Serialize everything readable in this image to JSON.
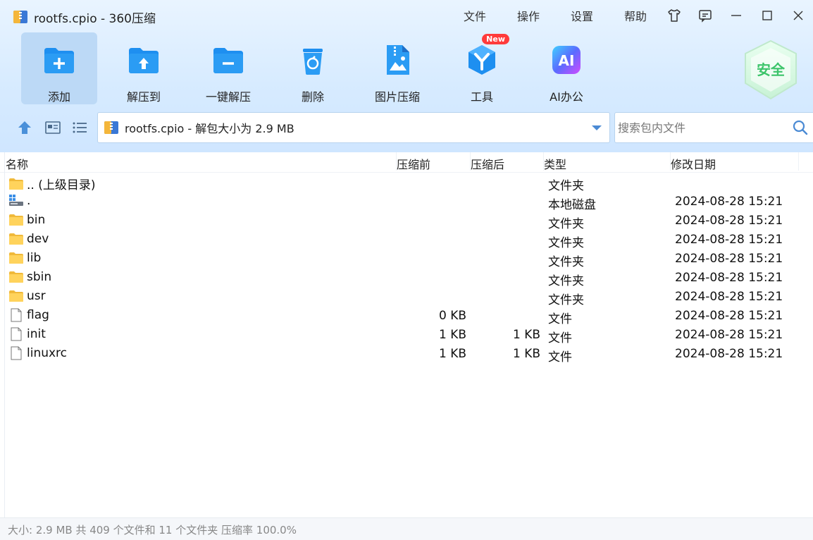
{
  "window": {
    "title": "rootfs.cpio - 360压缩"
  },
  "menu": [
    "文件",
    "操作",
    "设置",
    "帮助"
  ],
  "toolbar": [
    {
      "label": "添加",
      "icon": "add-folder-icon",
      "active": true
    },
    {
      "label": "解压到",
      "icon": "extract-to-icon"
    },
    {
      "label": "一键解压",
      "icon": "one-click-extract-icon"
    },
    {
      "label": "删除",
      "icon": "delete-icon"
    },
    {
      "label": "图片压缩",
      "icon": "image-compress-icon"
    },
    {
      "label": "工具",
      "icon": "tools-icon",
      "badge": "New"
    },
    {
      "label": "AI办公",
      "icon": "ai-office-icon"
    }
  ],
  "security_badge": "安全",
  "address": {
    "path": "rootfs.cpio - 解包大小为 2.9 MB"
  },
  "search": {
    "placeholder": "搜索包内文件"
  },
  "columns": {
    "name": "名称",
    "before": "压缩前",
    "after": "压缩后",
    "type": "类型",
    "date": "修改日期"
  },
  "rows": [
    {
      "name": ".. (上级目录)",
      "icon": "folder-icon",
      "before": "",
      "after": "",
      "type": "文件夹",
      "date": ""
    },
    {
      "name": ".",
      "icon": "local-disk-icon",
      "before": "",
      "after": "",
      "type": "本地磁盘",
      "date": "2024-08-28 15:21"
    },
    {
      "name": "bin",
      "icon": "folder-icon",
      "before": "",
      "after": "",
      "type": "文件夹",
      "date": "2024-08-28 15:21"
    },
    {
      "name": "dev",
      "icon": "folder-icon",
      "before": "",
      "after": "",
      "type": "文件夹",
      "date": "2024-08-28 15:21"
    },
    {
      "name": "lib",
      "icon": "folder-icon",
      "before": "",
      "after": "",
      "type": "文件夹",
      "date": "2024-08-28 15:21"
    },
    {
      "name": "sbin",
      "icon": "folder-icon",
      "before": "",
      "after": "",
      "type": "文件夹",
      "date": "2024-08-28 15:21"
    },
    {
      "name": "usr",
      "icon": "folder-icon",
      "before": "",
      "after": "",
      "type": "文件夹",
      "date": "2024-08-28 15:21"
    },
    {
      "name": "flag",
      "icon": "file-icon",
      "before": "0 KB",
      "after": "",
      "type": "文件",
      "date": "2024-08-28 15:21"
    },
    {
      "name": "init",
      "icon": "file-icon",
      "before": "1 KB",
      "after": "1 KB",
      "type": "文件",
      "date": "2024-08-28 15:21"
    },
    {
      "name": "linuxrc",
      "icon": "file-icon",
      "before": "1 KB",
      "after": "1 KB",
      "type": "文件",
      "date": "2024-08-28 15:21"
    }
  ],
  "status": "大小: 2.9 MB 共 409 个文件和 11 个文件夹 压缩率 100.0%",
  "colors": {
    "accent": "#1e8ff0",
    "toolbar_bg": "#d7ebff",
    "active_tool": "#bcd9f6",
    "badge": "#ff3b3b",
    "shield": "#3cc46a"
  }
}
